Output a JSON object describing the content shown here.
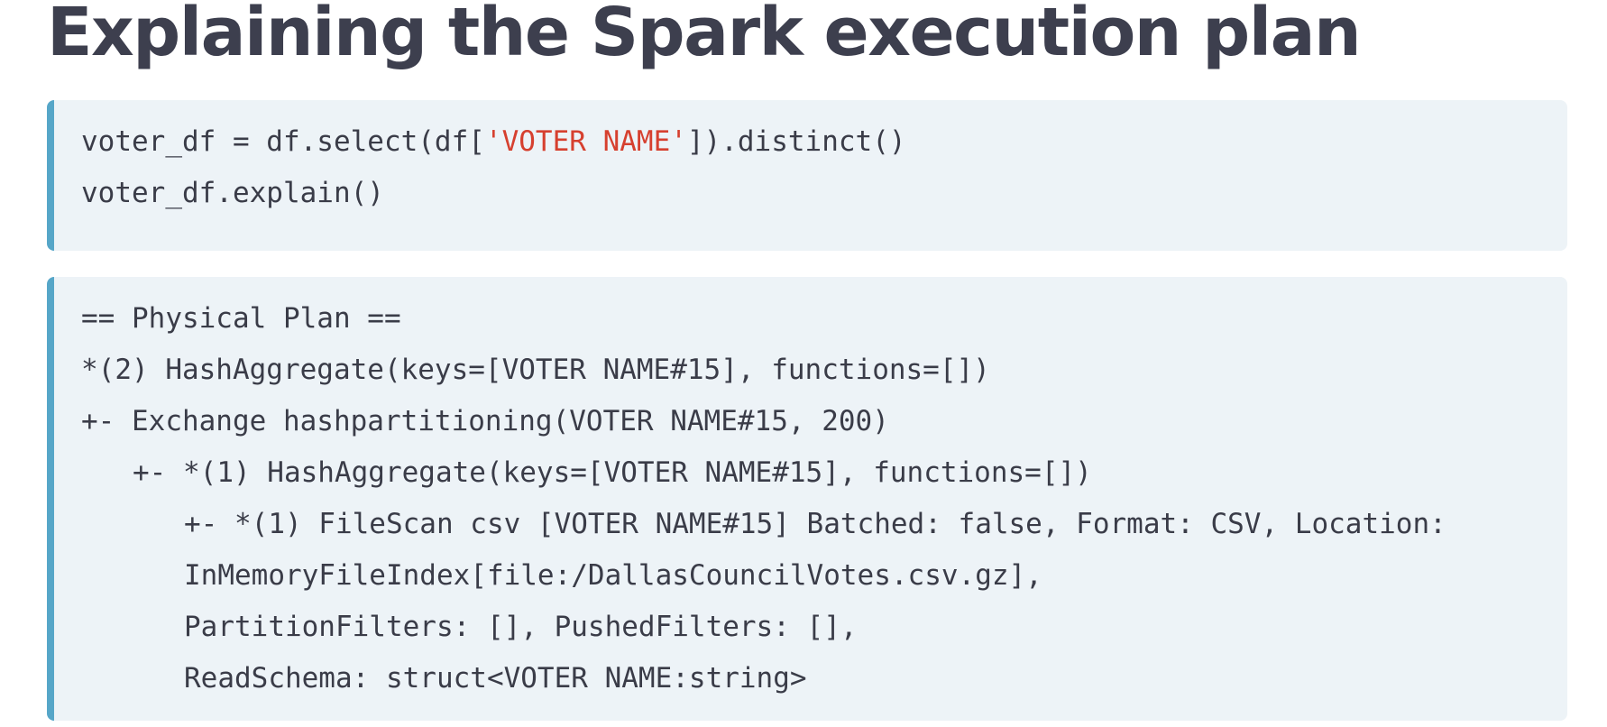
{
  "slide": {
    "title": "Explaining the Spark execution plan"
  },
  "code_block": {
    "line1": {
      "prefix": "voter_df = df.select(df[",
      "string": "'VOTER NAME'",
      "suffix": "]).distinct()"
    },
    "line2": "voter_df.explain()"
  },
  "plan_block": {
    "lines": [
      "== Physical Plan ==",
      "*(2) HashAggregate(keys=[VOTER NAME#15], functions=[])",
      "+- Exchange hashpartitioning(VOTER NAME#15, 200)",
      "+- *(1) HashAggregate(keys=[VOTER NAME#15], functions=[])",
      "+- *(1) FileScan csv [VOTER NAME#15] Batched: false, Format: CSV, Location:",
      "InMemoryFileIndex[file:/DallasCouncilVotes.csv.gz],",
      "PartitionFilters: [], PushedFilters: [],",
      "ReadSchema: struct<VOTER NAME:string>"
    ]
  },
  "colors": {
    "title": "#3d3f4e",
    "code_background": "#edf3f7",
    "accent_border": "#56a6c8",
    "string_literal": "#d6402f",
    "code_text": "#3a3c48"
  }
}
